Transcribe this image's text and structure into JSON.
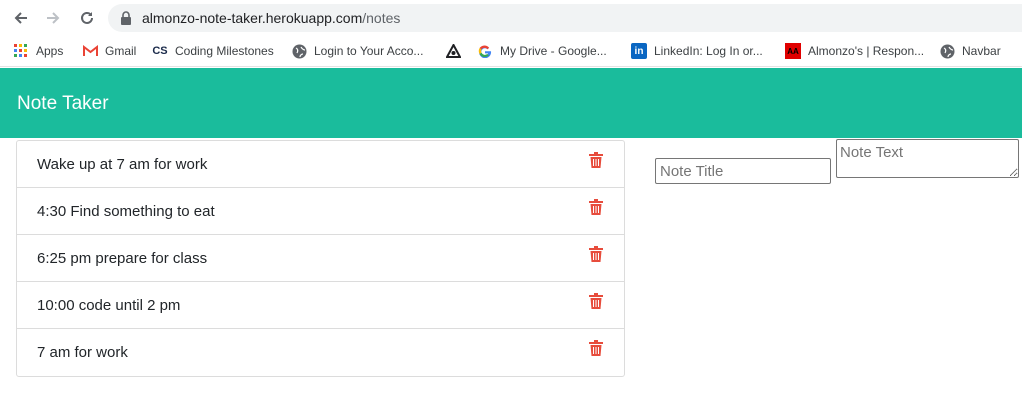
{
  "browser": {
    "url_domain": "almonzo-note-taker.herokuapp.com",
    "url_path": "/notes"
  },
  "bookmarks": [
    {
      "label": "Apps",
      "icon": "apps-grid-icon"
    },
    {
      "label": "Gmail",
      "icon": "gmail-icon"
    },
    {
      "label": "Coding Milestones",
      "icon": "cs-icon"
    },
    {
      "label": "Login to Your Acco...",
      "icon": "globe-icon"
    },
    {
      "label": "",
      "icon": "triangle-logo-icon"
    },
    {
      "label": "My Drive - Google...",
      "icon": "google-icon"
    },
    {
      "label": "LinkedIn: Log In or...",
      "icon": "linkedin-icon"
    },
    {
      "label": "Almonzo's | Respon...",
      "icon": "portfolio-icon"
    },
    {
      "label": "Navbar",
      "icon": "globe-icon"
    }
  ],
  "app": {
    "title": "Note Taker",
    "accent_color": "#1abc9c",
    "delete_color": "#e74c3c"
  },
  "notes": [
    {
      "title": "Wake up at 7 am for work"
    },
    {
      "title": "4:30 Find something to eat"
    },
    {
      "title": "6:25 pm prepare for class"
    },
    {
      "title": "10:00 code until 2 pm"
    },
    {
      "title": "7 am for work"
    }
  ],
  "form": {
    "title_placeholder": "Note Title",
    "text_placeholder": "Note Text"
  }
}
